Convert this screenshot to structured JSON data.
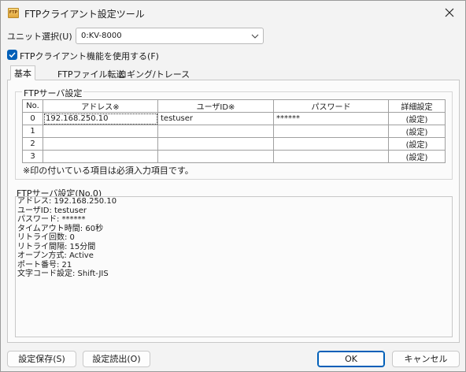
{
  "window": {
    "title": "FTPクライアント設定ツール",
    "app_icon_text": "FTP"
  },
  "unit": {
    "label": "ユニット選択(U)",
    "value": "0:KV-8000"
  },
  "enable": {
    "label": "FTPクライアント機能を使用する(F)",
    "checked": true
  },
  "tabs": [
    {
      "label": "基本",
      "active": true
    },
    {
      "label": "FTPファイル転送",
      "active": false
    },
    {
      "label": "ロギング/トレース",
      "active": false
    }
  ],
  "server_group": {
    "title": "FTPサーバ設定",
    "columns": [
      "No.",
      "アドレス※",
      "ユーザID※",
      "パスワード",
      "詳細設定"
    ],
    "rows": [
      {
        "no": "0",
        "address": "192.168.250.10",
        "user": "testuser",
        "password": "******",
        "detail": "(設定)"
      },
      {
        "no": "1",
        "address": "",
        "user": "",
        "password": "",
        "detail": "(設定)"
      },
      {
        "no": "2",
        "address": "",
        "user": "",
        "password": "",
        "detail": "(設定)"
      },
      {
        "no": "3",
        "address": "",
        "user": "",
        "password": "",
        "detail": "(設定)"
      }
    ],
    "note": "※印の付いている項目は必須入力項目です。"
  },
  "detail": {
    "title": "FTPサーバ設定(No.0)",
    "lines": [
      "アドレス: 192.168.250.10",
      "ユーザID: testuser",
      "パスワード: ******",
      "タイムアウト時間: 60秒",
      "リトライ回数: 0",
      "リトライ間隔: 15分間",
      "オープン方式: Active",
      "ポート番号: 21",
      "文字コード設定: Shift-JIS"
    ]
  },
  "buttons": {
    "save": "設定保存(S)",
    "load": "設定読出(O)",
    "ok": "OK",
    "cancel": "キャンセル"
  },
  "colors": {
    "accent": "#005fb8",
    "window_bg": "#f3f3f3"
  }
}
